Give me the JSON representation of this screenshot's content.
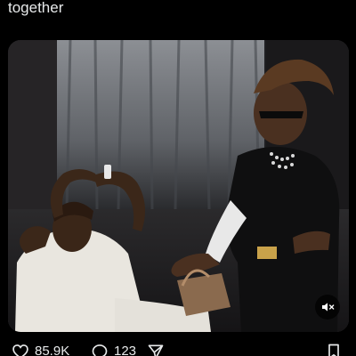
{
  "tweet": {
    "text": "together"
  },
  "media": {
    "mute_icon": "speaker-muted-icon"
  },
  "actions": {
    "like": {
      "icon": "heart-icon",
      "count": "85.9K"
    },
    "reply": {
      "icon": "speech-bubble-icon",
      "count": "123"
    },
    "share": {
      "icon": "share-icon"
    },
    "bookmark": {
      "icon": "bookmark-icon"
    }
  },
  "colors": {
    "background": "#000000",
    "text": "#e7e9ea",
    "icon": "#e7e9ea"
  }
}
